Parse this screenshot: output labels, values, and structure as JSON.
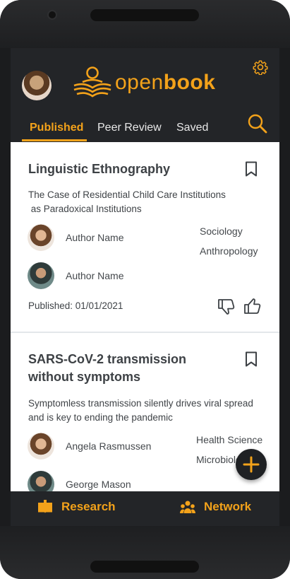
{
  "app": {
    "name_light": "open",
    "name_bold": "book",
    "accent_color": "#f3a21a",
    "header_bg": "#232528"
  },
  "header": {
    "avatar_icon": "user-avatar",
    "settings_icon": "gear-icon",
    "search_icon": "search-icon"
  },
  "tabs": [
    {
      "label": "Published",
      "active": true
    },
    {
      "label": "Peer Review",
      "active": false
    },
    {
      "label": "Saved",
      "active": false
    }
  ],
  "papers": [
    {
      "title": "Linguistic Ethnography",
      "abstract_line1": "The Case of Residential Child Care Institutions",
      "abstract_line2": " as Paradoxical Institutions",
      "authors": [
        "Author Name",
        "Author Name"
      ],
      "fields": [
        "Sociology",
        "Anthropology"
      ],
      "published": "Published: 01/01/2021"
    },
    {
      "title_line1": "SARS-CoV-2 transmission",
      "title_line2": "without symptoms",
      "abstract_line1": "Symptomless transmission silently drives viral spread",
      "abstract_line2": "and is key to ending the pandemic",
      "authors": [
        "Angela Rasmussen",
        "George Mason"
      ],
      "fields": [
        "Health Science",
        "Microbiology"
      ]
    }
  ],
  "bottom_nav": [
    {
      "label": "Research",
      "icon": "book-icon"
    },
    {
      "label": "Network",
      "icon": "people-icon"
    }
  ],
  "fab_icon": "plus-icon"
}
